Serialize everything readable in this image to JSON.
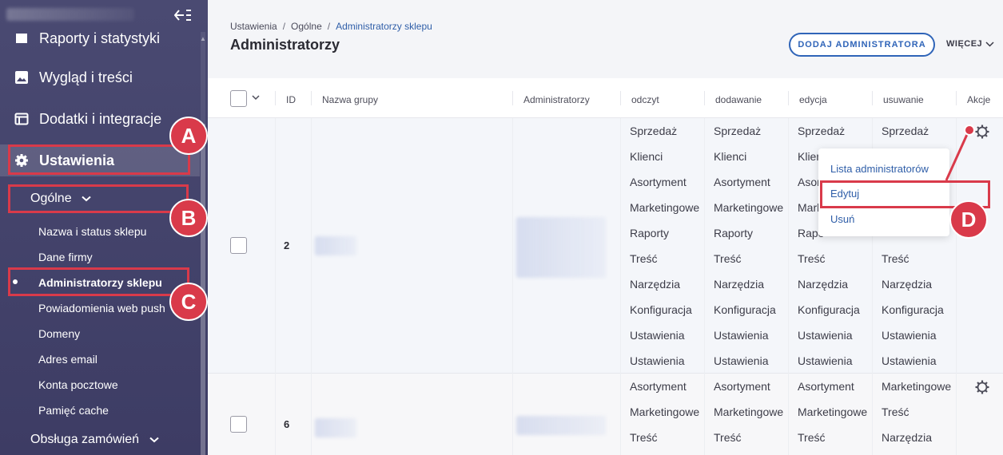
{
  "sidebar": {
    "items": [
      {
        "label": "Raporty i statystyki",
        "icon": "report-icon"
      },
      {
        "label": "Wygląd i treści",
        "icon": "image-icon"
      },
      {
        "label": "Dodatki i integracje",
        "icon": "window-icon"
      },
      {
        "label": "Ustawienia",
        "icon": "gear-icon"
      }
    ],
    "submenu_head": "Ogólne",
    "subitems": [
      "Nazwa i status sklepu",
      "Dane firmy",
      "Administratorzy sklepu",
      "Powiadomienia web push",
      "Domeny",
      "Adres email",
      "Konta pocztowe",
      "Pamięć cache"
    ],
    "next_group": "Obsługa zamówień"
  },
  "breadcrumb": [
    "Ustawienia",
    "Ogólne",
    "Administratorzy sklepu"
  ],
  "page_title": "Administratorzy",
  "add_button": "DODAJ ADMINISTRATORA",
  "more_button": "WIĘCEJ",
  "table": {
    "headers": {
      "id": "ID",
      "group": "Nazwa grupy",
      "admins": "Administratorzy",
      "read": "odczyt",
      "add": "dodawanie",
      "edit": "edycja",
      "delete": "usuwanie",
      "actions": "Akcje"
    },
    "rows": [
      {
        "id": "2",
        "odczyt": [
          "Sprzedaż",
          "Klienci",
          "Asortyment",
          "Marketingowe",
          "Raporty",
          "Treść",
          "Narzędzia",
          "Konfiguracja",
          "Ustawienia",
          "Ustawienia"
        ],
        "dodawanie": [
          "Sprzedaż",
          "Klienci",
          "Asortyment",
          "Marketingowe",
          "Raporty",
          "Treść",
          "Narzędzia",
          "Konfiguracja",
          "Ustawienia",
          "Ustawienia"
        ],
        "edycja": [
          "Sprzedaż",
          "Klien",
          "Asor",
          "Mark",
          "Rapo",
          "Treść",
          "Narzędzia",
          "Konfiguracja",
          "Ustawienia",
          "Ustawienia"
        ],
        "usuwanie": [
          "Sprzedaż",
          "",
          "",
          "",
          "",
          "Treść",
          "Narzędzia",
          "Konfiguracja",
          "Ustawienia",
          "Ustawienia"
        ]
      },
      {
        "id": "6",
        "odczyt": [
          "Asortyment",
          "Marketingowe",
          "Treść"
        ],
        "dodawanie": [
          "Asortyment",
          "Marketingowe",
          "Treść"
        ],
        "edycja": [
          "Asortyment",
          "Marketingowe",
          "Treść"
        ],
        "usuwanie": [
          "Marketingowe",
          "Treść",
          "Narzędzia"
        ]
      }
    ]
  },
  "dropdown": [
    "Lista administratorów",
    "Edytuj",
    "Usuń"
  ],
  "annotations": [
    "A",
    "B",
    "C",
    "D"
  ],
  "colors": {
    "sidebar": "#45446c",
    "accent": "#2f64b8",
    "annotation": "#d93a4a"
  }
}
